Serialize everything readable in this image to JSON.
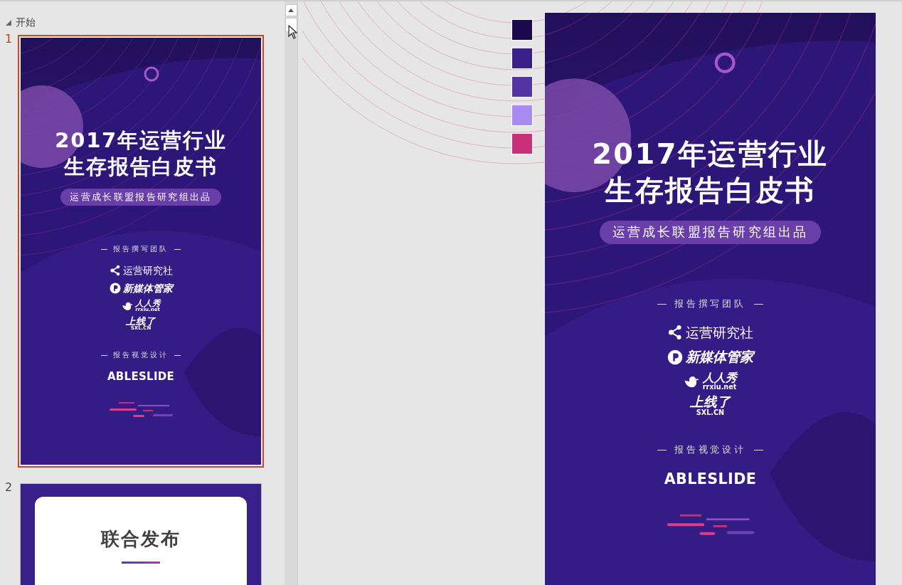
{
  "pane": {
    "section": {
      "label": "开始",
      "expanded": true
    },
    "slides": [
      {
        "number": "1",
        "selected": true,
        "kind": "cover",
        "cover": {
          "title_lines": [
            "2017年运营行业",
            "生存报告白皮书"
          ],
          "subtitle": "运营成长联盟报告研究组出品",
          "team_label": "报告撰写团队",
          "logos": [
            {
              "kind": "share",
              "name": "运营研究社"
            },
            {
              "kind": "badge",
              "name": "新媒体管家"
            },
            {
              "kind": "bird",
              "name": "人人秀",
              "sub": "rrxiu.net"
            },
            {
              "kind": "plain",
              "name": "上线了",
              "sub": "SXL.CN"
            }
          ],
          "design_label": "报告视觉设计",
          "designer": "ABLESLIDE"
        }
      },
      {
        "number": "2",
        "selected": false,
        "kind": "card",
        "title": "联合发布"
      }
    ]
  },
  "editor": {
    "swatches": [
      {
        "color": "#1c0a4e"
      },
      {
        "color": "#3a1f8a"
      },
      {
        "color": "#5535a5"
      },
      {
        "color": "#a98af0"
      },
      {
        "color": "#c9307a"
      }
    ],
    "slide": {
      "title_lines": [
        "2017年运营行业",
        "生存报告白皮书"
      ],
      "subtitle": "运营成长联盟报告研究组出品",
      "team_label": "报告撰写团队",
      "logos": [
        {
          "kind": "share",
          "name": "运营研究社"
        },
        {
          "kind": "badge",
          "name": "新媒体管家"
        },
        {
          "kind": "bird",
          "name": "人人秀",
          "sub": "rrxiu.net"
        },
        {
          "kind": "plain",
          "name": "上线了",
          "sub": "SXL.CN"
        }
      ],
      "design_label": "报告视觉设计",
      "designer": "ABLESLIDE"
    }
  }
}
